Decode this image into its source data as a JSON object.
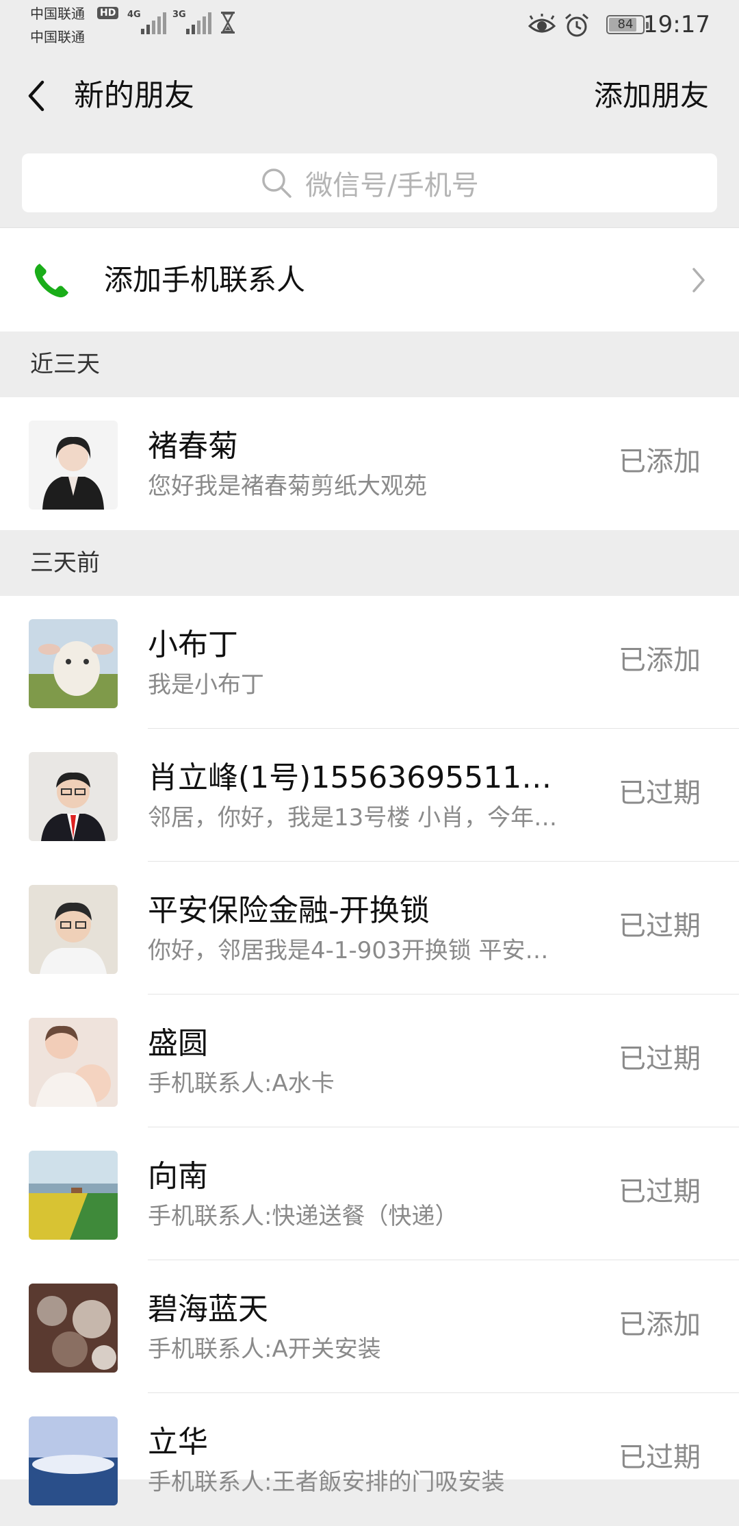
{
  "status_bar": {
    "carrier1": "中国联通",
    "carrier2": "中国联通",
    "hd": "HD",
    "sig1_label": "4G",
    "sig2_label": "3G",
    "battery": "84",
    "time": "19:17"
  },
  "header": {
    "title": "新的朋友",
    "add_friend": "添加朋友"
  },
  "search": {
    "placeholder": "微信号/手机号"
  },
  "add_contacts": {
    "label": "添加手机联系人",
    "accent": "#1aad19"
  },
  "sections": [
    {
      "title": "近三天",
      "items": [
        {
          "name": "褚春菊",
          "msg": "您好我是褚春菊剪纸大观苑",
          "status": "已添加"
        }
      ]
    },
    {
      "title": "三天前",
      "items": [
        {
          "name": "小布丁",
          "msg": "我是小布丁",
          "status": "已添加"
        },
        {
          "name": "肖立峰(1号)15563695511平…",
          "msg": "邻居，你好，我是13号楼 小肖，今年…",
          "status": "已过期"
        },
        {
          "name": "平安保险金融-开换锁",
          "msg": "你好，邻居我是4-1-903开换锁 平安…",
          "status": "已过期"
        },
        {
          "name": "盛圆",
          "msg": "手机联系人:A水卡",
          "status": "已过期"
        },
        {
          "name": "向南",
          "msg": "手机联系人:快递送餐（快递）",
          "status": "已过期"
        },
        {
          "name": "碧海蓝天",
          "msg": "手机联系人:A开关安装",
          "status": "已添加"
        },
        {
          "name": "立华",
          "msg": "手机联系人:王者飯安排的门吸安装",
          "status": "已过期"
        }
      ]
    }
  ]
}
